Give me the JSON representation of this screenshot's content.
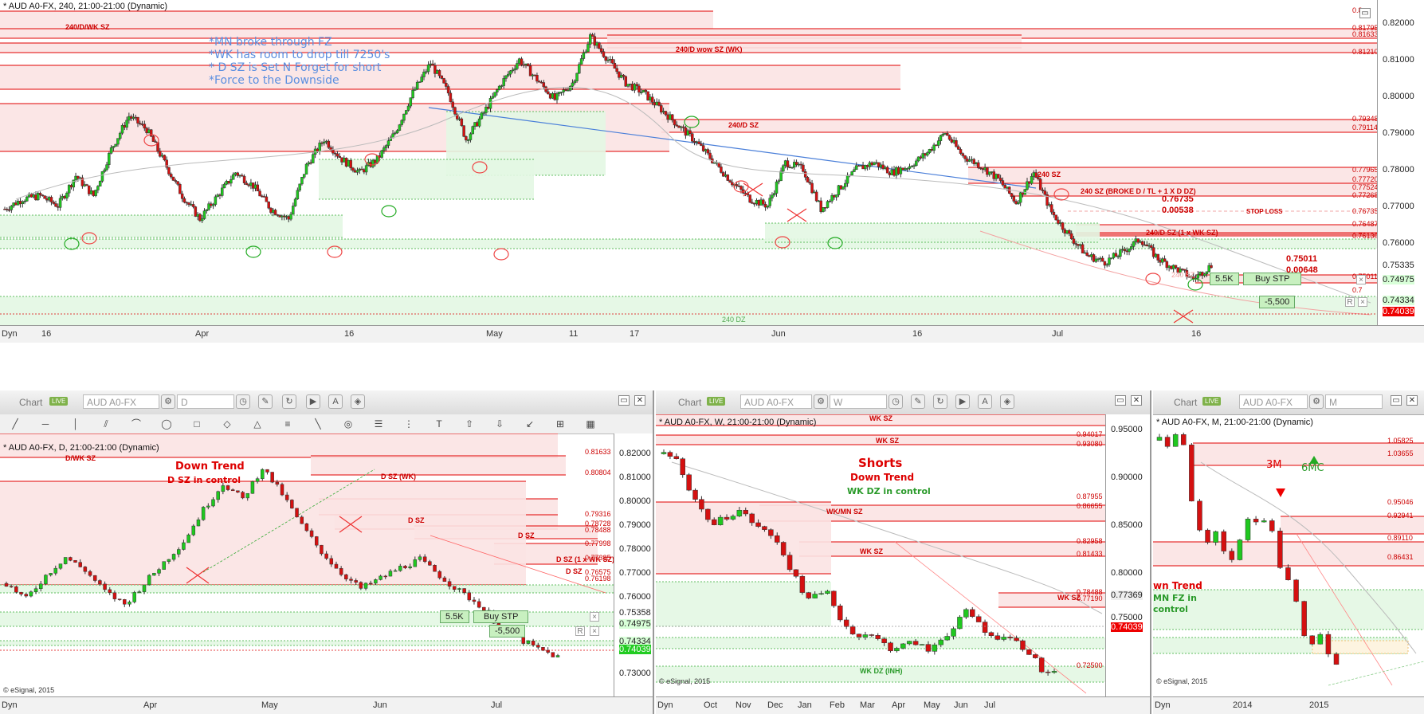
{
  "brand": "© eSignal, 2015",
  "colors": {
    "up": "#1fc81f",
    "down": "#d41010",
    "zone": "#fbe3e3",
    "zoneLine": "#e00000",
    "demand": "#e3f7e3",
    "demandLine": "#33aa33",
    "trend": "#4a7fd9"
  },
  "main": {
    "title": "* AUD A0-FX, 240, 21:00-21:00 (Dynamic)",
    "notes": [
      "*MN broke through FZ",
      "*WK has room to drop till 7250's",
      "* D SZ is Set N Forget for short",
      "*Force to the Downside"
    ],
    "zone_labels": [
      "240/D/WK SZ",
      "240/D wow SZ (WK)",
      "240/D SZ",
      "240 SZ",
      "240 SZ (BROKE D / TL + 1 X D DZ)",
      "240/D SZ (1 x WK SZ)",
      "240 DZ",
      "STOP LOSS"
    ],
    "annot": {
      "a": "0.76735",
      "b": "0.00538",
      "c": "0.75011",
      "d": "0.00648",
      "e": "240 SZ"
    },
    "y_levels": [
      "0.8",
      "0.81795",
      "0.81633",
      "0.81210",
      "0.79348",
      "0.79114",
      "0.77965",
      "0.77720",
      "0.77524",
      "0.77268",
      "0.76735",
      "0.76487",
      "0.76130",
      "0.75011",
      "0.7"
    ],
    "y_ticks": [
      "0.82000",
      "0.81000",
      "0.80000",
      "0.79000",
      "0.78000",
      "0.77000",
      "0.76000",
      "0.75335",
      "0.74975",
      "0.74334",
      "0.74039",
      "0.73000"
    ],
    "x_ticks": [
      "16",
      "Apr",
      "16",
      "May",
      "11",
      "17",
      "Jun",
      "16",
      "Jul",
      "16"
    ],
    "dyn": "Dyn",
    "trade": {
      "qty": "5.5K",
      "label": "Buy STP",
      "pnl": "-5,500"
    },
    "chart_data": {
      "type": "candlestick",
      "instrument": "AUD A0-FX",
      "timeframe": "240",
      "ylim": [
        0.726,
        0.824
      ],
      "close_path": [
        0.761,
        0.764,
        0.765,
        0.762,
        0.771,
        0.765,
        0.779,
        0.789,
        0.785,
        0.775,
        0.765,
        0.758,
        0.765,
        0.772,
        0.768,
        0.761,
        0.758,
        0.774,
        0.782,
        0.776,
        0.772,
        0.776,
        0.784,
        0.796,
        0.805,
        0.796,
        0.782,
        0.79,
        0.799,
        0.806,
        0.8,
        0.794,
        0.799,
        0.813,
        0.806,
        0.799,
        0.796,
        0.791,
        0.786,
        0.781,
        0.775,
        0.769,
        0.764,
        0.762,
        0.775,
        0.773,
        0.761,
        0.767,
        0.773,
        0.775,
        0.772,
        0.774,
        0.778,
        0.784,
        0.777,
        0.774,
        0.77,
        0.763,
        0.772,
        0.76,
        0.753,
        0.747,
        0.745,
        0.748,
        0.752,
        0.746,
        0.743,
        0.74,
        0.744
      ],
      "last": "0.74039"
    }
  },
  "daily": {
    "toolbar": {
      "label": "Chart",
      "live": "LIVE",
      "symbol": "AUD A0-FX",
      "interval": "D"
    },
    "title": "* AUD A0-FX, D, 21:00-21:00 (Dynamic)",
    "headline": [
      "Down Trend",
      "D SZ in control"
    ],
    "zone_labels": [
      "D/WK SZ",
      "D SZ (WK)",
      "D SZ",
      "D SZ",
      "D SZ (1 x WK SZ)",
      "D SZ"
    ],
    "y_levels": [
      "0.81633",
      "0.80804",
      "0.79316",
      "0.78728",
      "0.78488",
      "0.77998",
      "0.77385",
      "0.76575",
      "0.76198"
    ],
    "y_ticks": [
      "0.82000",
      "0.81000",
      "0.80000",
      "0.79000",
      "0.78000",
      "0.77000",
      "0.76000",
      "0.75358",
      "0.74975",
      "0.74334",
      "0.74039",
      "0.73000"
    ],
    "x_ticks": [
      "Apr",
      "May",
      "Jun",
      "Jul"
    ],
    "dyn": "Dyn",
    "trade": {
      "qty": "5.5K",
      "label": "Buy STP",
      "pnl": "-5,500"
    },
    "chart_data": {
      "type": "candlestick",
      "timeframe": "D",
      "ylim": [
        0.725,
        0.825
      ],
      "close_path": [
        0.768,
        0.762,
        0.771,
        0.778,
        0.773,
        0.765,
        0.76,
        0.768,
        0.776,
        0.784,
        0.796,
        0.806,
        0.8,
        0.812,
        0.802,
        0.79,
        0.78,
        0.772,
        0.766,
        0.77,
        0.774,
        0.777,
        0.771,
        0.765,
        0.76,
        0.752,
        0.747,
        0.743,
        0.74
      ]
    }
  },
  "weekly": {
    "toolbar": {
      "label": "Chart",
      "live": "LIVE",
      "symbol": "AUD A0-FX",
      "interval": "W"
    },
    "title": "* AUD A0-FX, W, 21:00-21:00 (Dynamic)",
    "headline": [
      "Shorts",
      "Down Trend",
      "WK DZ in control"
    ],
    "zone_labels": [
      "WK SZ",
      "WK SZ",
      "WK/MN SZ",
      "WK SZ",
      "WK SZ",
      "WK DZ (INH)"
    ],
    "y_levels": [
      "0.94017",
      "0.93080",
      "0.87955",
      "0.86655",
      "0.82958",
      "0.81433",
      "0.78488",
      "0.77190",
      "0.72500"
    ],
    "y_ticks": [
      "0.95000",
      "0.90000",
      "0.85000",
      "0.80000",
      "0.77369",
      "0.75000",
      "0.74039"
    ],
    "x_ticks": [
      "Oct",
      "Nov",
      "Dec",
      "Jan",
      "Feb",
      "Mar",
      "Apr",
      "May",
      "Jun",
      "Jul"
    ],
    "dyn": "Dyn",
    "chart_data": {
      "type": "candlestick",
      "timeframe": "W",
      "ylim": [
        0.72,
        0.97
      ],
      "close_path": [
        0.935,
        0.93,
        0.905,
        0.885,
        0.872,
        0.88,
        0.885,
        0.875,
        0.866,
        0.858,
        0.835,
        0.812,
        0.808,
        0.812,
        0.79,
        0.775,
        0.776,
        0.77,
        0.763,
        0.765,
        0.768,
        0.76,
        0.772,
        0.78,
        0.795,
        0.786,
        0.772,
        0.775,
        0.768,
        0.76,
        0.743,
        0.74
      ]
    }
  },
  "monthly": {
    "toolbar": {
      "label": "Chart",
      "live": "LIVE",
      "symbol": "AUD A0-FX",
      "interval": "M"
    },
    "title": "* AUD A0-FX, M, 21:00-21:00 (Dynamic)",
    "headline": [
      "wn Trend",
      "MN FZ in",
      "control"
    ],
    "markers": {
      "down": "3M",
      "up": "6MC"
    },
    "y_levels": [
      "1.05825",
      "1.03655",
      "0.95046",
      "0.92941",
      "0.89110",
      "0.86431"
    ],
    "x_ticks": [
      "2014",
      "2015"
    ],
    "dyn": "Dyn",
    "chart_data": {
      "type": "candlestick",
      "timeframe": "M",
      "ylim": [
        0.7,
        1.08
      ],
      "close_path": [
        1.045,
        1.04,
        1.05,
        1.04,
        0.965,
        0.92,
        0.905,
        0.925,
        0.895,
        0.885,
        0.915,
        0.935,
        0.935,
        0.94,
        0.925,
        0.875,
        0.855,
        0.825,
        0.785,
        0.775,
        0.78,
        0.76,
        0.745
      ]
    }
  }
}
